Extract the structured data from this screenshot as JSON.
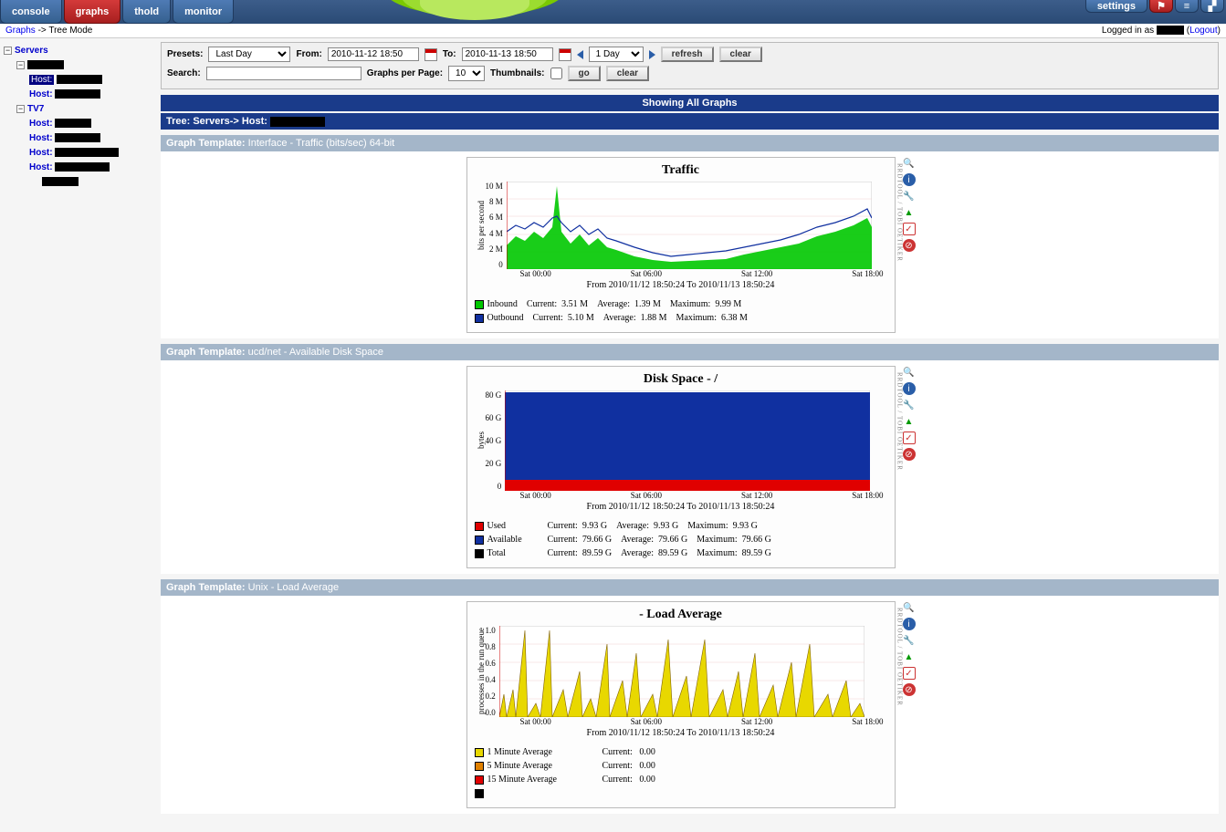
{
  "nav": {
    "tabs": [
      "console",
      "graphs",
      "thold",
      "monitor"
    ],
    "active": "graphs",
    "right": {
      "settings": "settings"
    }
  },
  "breadcrumb": {
    "root": "Graphs",
    "sep": " -> ",
    "leaf": "Tree Mode"
  },
  "login": {
    "prefix": "Logged in as ",
    "logout": "Logout"
  },
  "tree": {
    "root": "Servers",
    "hostLabel": "Host:",
    "group2": "TV7"
  },
  "filter": {
    "presetsLbl": "Presets:",
    "preset": "Last Day",
    "fromLbl": "From:",
    "from": "2010-11-12 18:50",
    "toLbl": "To:",
    "to": "2010-11-13 18:50",
    "shift": "1 Day",
    "refreshBtn": "refresh",
    "clearBtn": "clear",
    "searchLbl": "Search:",
    "gppLbl": "Graphs per Page:",
    "gpp": "10",
    "thumbsLbl": "Thumbnails:",
    "goBtn": "go",
    "clearBtn2": "clear"
  },
  "headers": {
    "showing": "Showing All Graphs",
    "treeLine": "Tree: Servers-> Host:",
    "gt": "Graph Template:",
    "gt1": "Interface - Traffic (bits/sec) 64-bit",
    "gt2": "ucd/net - Available Disk Space",
    "gt3": "Unix - Load Average"
  },
  "chart_data": [
    {
      "type": "area",
      "title": "Traffic",
      "ylabel": "bits per second",
      "ylim": [
        0,
        10000000
      ],
      "yticks": [
        "10 M",
        "8 M",
        "6 M",
        "4 M",
        "2 M",
        "0"
      ],
      "xticks": [
        "Sat 00:00",
        "Sat 06:00",
        "Sat 12:00",
        "Sat 18:00"
      ],
      "from_to": "From 2010/11/12 18:50:24 To 2010/11/13 18:50:24",
      "series": [
        {
          "name": "Inbound",
          "color": "#00c800",
          "stats": {
            "Current": "3.51 M",
            "Average": "1.39 M",
            "Maximum": "9.99 M"
          }
        },
        {
          "name": "Outbound",
          "color": "#1030a0",
          "stats": {
            "Current": "5.10 M",
            "Average": "1.88 M",
            "Maximum": "6.38 M"
          }
        }
      ]
    },
    {
      "type": "area",
      "title": "Disk Space - /",
      "ylabel": "bytes",
      "ylim": [
        0,
        90
      ],
      "yticks": [
        "80 G",
        "60 G",
        "40 G",
        "20 G",
        "0"
      ],
      "xticks": [
        "Sat 00:00",
        "Sat 06:00",
        "Sat 12:00",
        "Sat 18:00"
      ],
      "from_to": "From 2010/11/12 18:50:24 To 2010/11/13 18:50:24",
      "series": [
        {
          "name": "Used",
          "color": "#e00000",
          "stats": {
            "Current": "9.93 G",
            "Average": "9.93 G",
            "Maximum": "9.93 G"
          }
        },
        {
          "name": "Available",
          "color": "#1030a0",
          "stats": {
            "Current": "79.66 G",
            "Average": "79.66 G",
            "Maximum": "79.66 G"
          }
        },
        {
          "name": "Total",
          "color": "#000000",
          "stats": {
            "Current": "89.59 G",
            "Average": "89.59 G",
            "Maximum": "89.59 G"
          }
        }
      ]
    },
    {
      "type": "line",
      "title": "- Load Average",
      "ylabel": "processes in the run queue",
      "ylim": [
        0,
        1.0
      ],
      "yticks": [
        "1.0",
        "0.8",
        "0.6",
        "0.4",
        "0.2",
        "0.0"
      ],
      "xticks": [
        "Sat 00:00",
        "Sat 06:00",
        "Sat 12:00",
        "Sat 18:00"
      ],
      "from_to": "From 2010/11/12 18:50:24 To 2010/11/13 18:50:24",
      "series": [
        {
          "name": "1 Minute Average",
          "color": "#e8d800",
          "stats": {
            "Current": "0.00"
          }
        },
        {
          "name": "5 Minute Average",
          "color": "#e08000",
          "stats": {
            "Current": "0.00"
          }
        },
        {
          "name": "15 Minute Average",
          "color": "#e00000",
          "stats": {
            "Current": "0.00"
          }
        }
      ]
    }
  ]
}
